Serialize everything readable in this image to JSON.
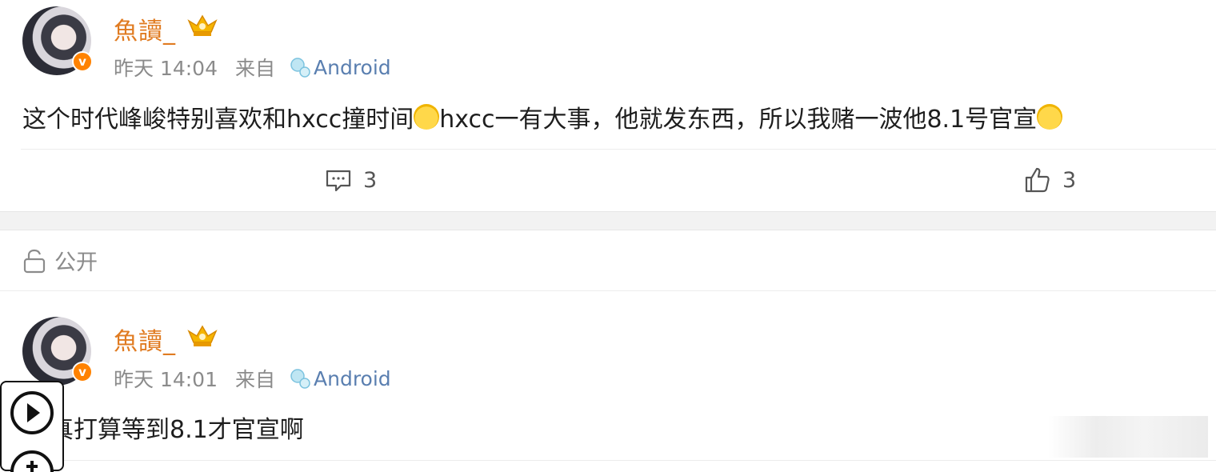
{
  "posts": [
    {
      "username": "魚讀_",
      "time": "昨天 14:04",
      "source_prefix": "来自",
      "device": "Android",
      "content_before_emoji": "这个时代峰峻特别喜欢和hxcc撞时间",
      "content_middle": "hxcc一有大事，他就发东西，所以我赌一波他8.1号官宣",
      "emojis": [
        "laughing-tears-emoji",
        "crying-emoji"
      ],
      "comment_count": "3",
      "like_count": "3"
    },
    {
      "username": "魚讀_",
      "time": "昨天 14:01",
      "source_prefix": "来自",
      "device": "Android",
      "content": "真打算等到8.1才官宣啊"
    }
  ],
  "privacy_label": "公开",
  "verified_badge": "v",
  "colors": {
    "username": "#e07b21",
    "badge": "#ff8200",
    "device": "#5a7fb0",
    "meta": "#8b8b8b",
    "separator": "#f2f2f2"
  },
  "icons": [
    "comment-icon",
    "like-icon",
    "lock-icon",
    "crown-icon",
    "bubble-icon",
    "play-icon",
    "plus-icon"
  ]
}
